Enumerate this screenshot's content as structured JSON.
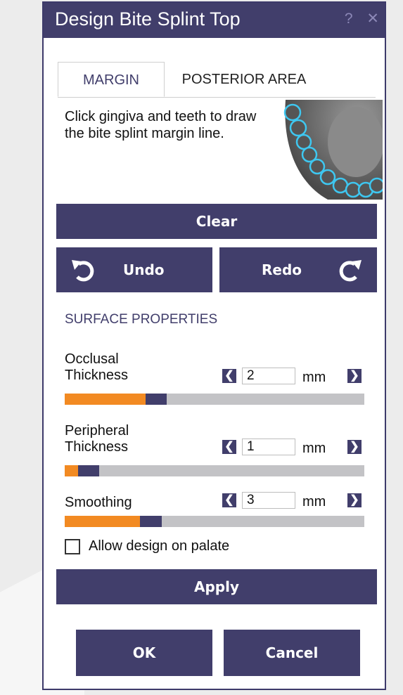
{
  "dialog": {
    "title": "Design Bite Splint Top",
    "help_icon": "?",
    "close_icon": "✕"
  },
  "tabs": [
    {
      "label": "MARGIN",
      "active": true
    },
    {
      "label": "POSTERIOR AREA",
      "active": false
    }
  ],
  "instruction": "Click gingiva and teeth to draw the bite splint margin line.",
  "buttons": {
    "clear": "Clear",
    "undo": "Undo",
    "redo": "Redo",
    "apply": "Apply",
    "ok": "OK",
    "cancel": "Cancel"
  },
  "section_title": "SURFACE PROPERTIES",
  "properties": [
    {
      "label": "Occlusal Thickness",
      "value": "2",
      "unit": "mm",
      "fill_orange_pct": 27,
      "fill_dark_pct": 7
    },
    {
      "label": "Peripheral Thickness",
      "value": "1",
      "unit": "mm",
      "fill_orange_pct": 4.5,
      "fill_dark_pct": 7
    },
    {
      "label": "Smoothing",
      "value": "3",
      "unit": "mm",
      "fill_orange_pct": 25,
      "fill_dark_pct": 7.5
    }
  ],
  "palate_option": {
    "label": "Allow design on palate",
    "checked": false
  },
  "colors": {
    "accent": "#413e6b",
    "slider_fill": "#f28a22",
    "track": "#c3c3c6",
    "tooth_outline": "#3ec7f0"
  },
  "icons": {
    "undo": "undo-arrow-icon",
    "redo": "redo-arrow-icon",
    "decrease": "chevron-left-icon",
    "increase": "chevron-right-icon"
  }
}
